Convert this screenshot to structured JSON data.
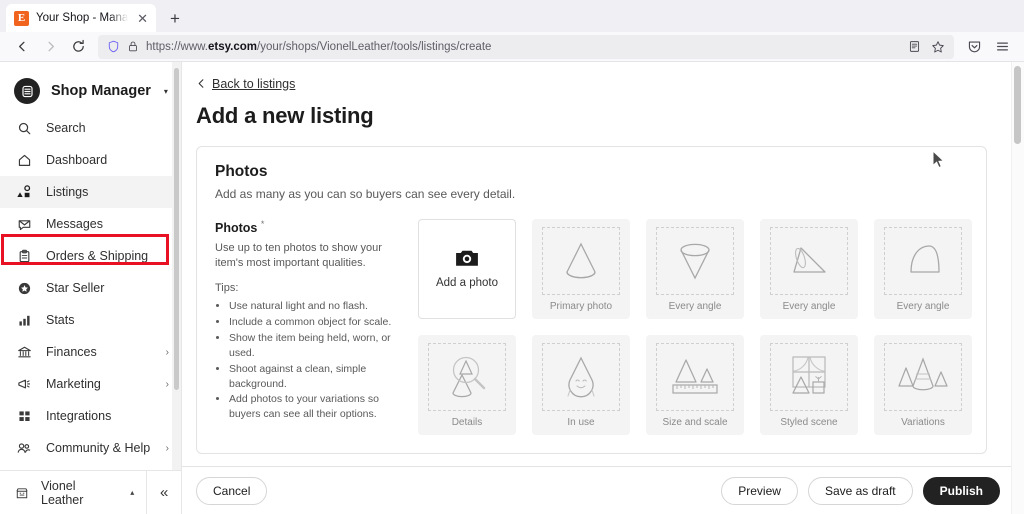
{
  "browser": {
    "tab": {
      "title": "Your Shop - Manage Listin",
      "favicon_letter": "E",
      "close_icon": "close-icon"
    },
    "new_tab_label": "+",
    "nav": {
      "back": "←",
      "forward": "→",
      "reload": "⟳"
    },
    "url": {
      "prefix": "https://www.",
      "domain": "etsy.com",
      "path": "/your/shops/VionelLeather/tools/listings/create"
    },
    "toolbar_icons": [
      "reader-view-icon",
      "bookmark-star-icon",
      "pocket-icon",
      "app-menu-icon"
    ]
  },
  "sidebar": {
    "brand": {
      "label": "Shop Manager",
      "caret": "▾"
    },
    "items": [
      {
        "label": "Search",
        "icon": "search-icon",
        "chevron": ""
      },
      {
        "label": "Dashboard",
        "icon": "home-icon",
        "chevron": ""
      },
      {
        "label": "Listings",
        "icon": "listings-icon",
        "chevron": "",
        "highlighted": true
      },
      {
        "label": "Messages",
        "icon": "envelope-icon",
        "chevron": ""
      },
      {
        "label": "Orders & Shipping",
        "icon": "clipboard-icon",
        "chevron": ""
      },
      {
        "label": "Star Seller",
        "icon": "star-badge-icon",
        "chevron": ""
      },
      {
        "label": "Stats",
        "icon": "bar-chart-icon",
        "chevron": ""
      },
      {
        "label": "Finances",
        "icon": "bank-icon",
        "chevron": "›"
      },
      {
        "label": "Marketing",
        "icon": "megaphone-icon",
        "chevron": "›"
      },
      {
        "label": "Integrations",
        "icon": "grid-icon",
        "chevron": ""
      },
      {
        "label": "Community & Help",
        "icon": "people-icon",
        "chevron": "›"
      }
    ],
    "footer": {
      "shop_name": "Vionel Leather",
      "caret": "▴",
      "collapse_icon": "«"
    },
    "highlight_color": "#e81123"
  },
  "main": {
    "back_link": "Back to listings",
    "page_title": "Add a new listing",
    "card": {
      "title": "Photos",
      "subtitle": "Add as many as you can so buyers can see every detail.",
      "tips": {
        "heading": "Photos",
        "required_marker": "*",
        "description": "Use up to ten photos to show your item's most important qualities.",
        "tips_label": "Tips:",
        "items": [
          "Use natural light and no flash.",
          "Include a common object for scale.",
          "Show the item being held, worn, or used.",
          "Shoot against a clean, simple background.",
          "Add photos to your variations so buyers can see all their options."
        ]
      },
      "tiles": [
        {
          "label": "Add a photo",
          "kind": "upload",
          "icon": "camera-icon"
        },
        {
          "label": "Primary photo",
          "kind": "placeholder",
          "icon": "cone-icon"
        },
        {
          "label": "Every angle",
          "kind": "placeholder",
          "icon": "cone-inverted-icon"
        },
        {
          "label": "Every angle",
          "kind": "placeholder",
          "icon": "cone-side-icon"
        },
        {
          "label": "Every angle",
          "kind": "placeholder",
          "icon": "cone-top-icon"
        },
        {
          "label": "Details",
          "kind": "placeholder",
          "icon": "magnifier-cone-icon"
        },
        {
          "label": "In use",
          "kind": "placeholder",
          "icon": "cone-face-icon"
        },
        {
          "label": "Size and scale",
          "kind": "placeholder",
          "icon": "ruler-cones-icon"
        },
        {
          "label": "Styled scene",
          "kind": "placeholder",
          "icon": "window-scene-icon"
        },
        {
          "label": "Variations",
          "kind": "placeholder",
          "icon": "three-cones-icon"
        }
      ]
    },
    "actions": {
      "cancel": "Cancel",
      "preview": "Preview",
      "save_draft": "Save as draft",
      "publish": "Publish"
    }
  }
}
